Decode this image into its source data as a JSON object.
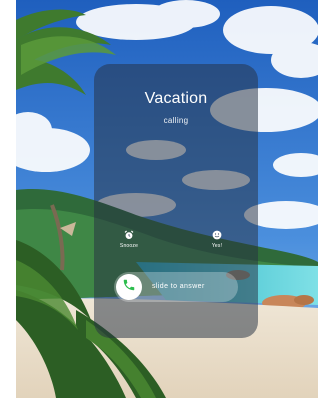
{
  "call": {
    "caller_name": "Vacation",
    "status": "calling"
  },
  "actions": {
    "snooze": {
      "label": "Snooze",
      "icon": "alarm-clock-icon"
    },
    "yes": {
      "label": "Yes!",
      "icon": "smile-icon"
    }
  },
  "answer": {
    "label": "slide to answer",
    "icon": "phone-icon",
    "accent_color": "#2dbd4e"
  }
}
